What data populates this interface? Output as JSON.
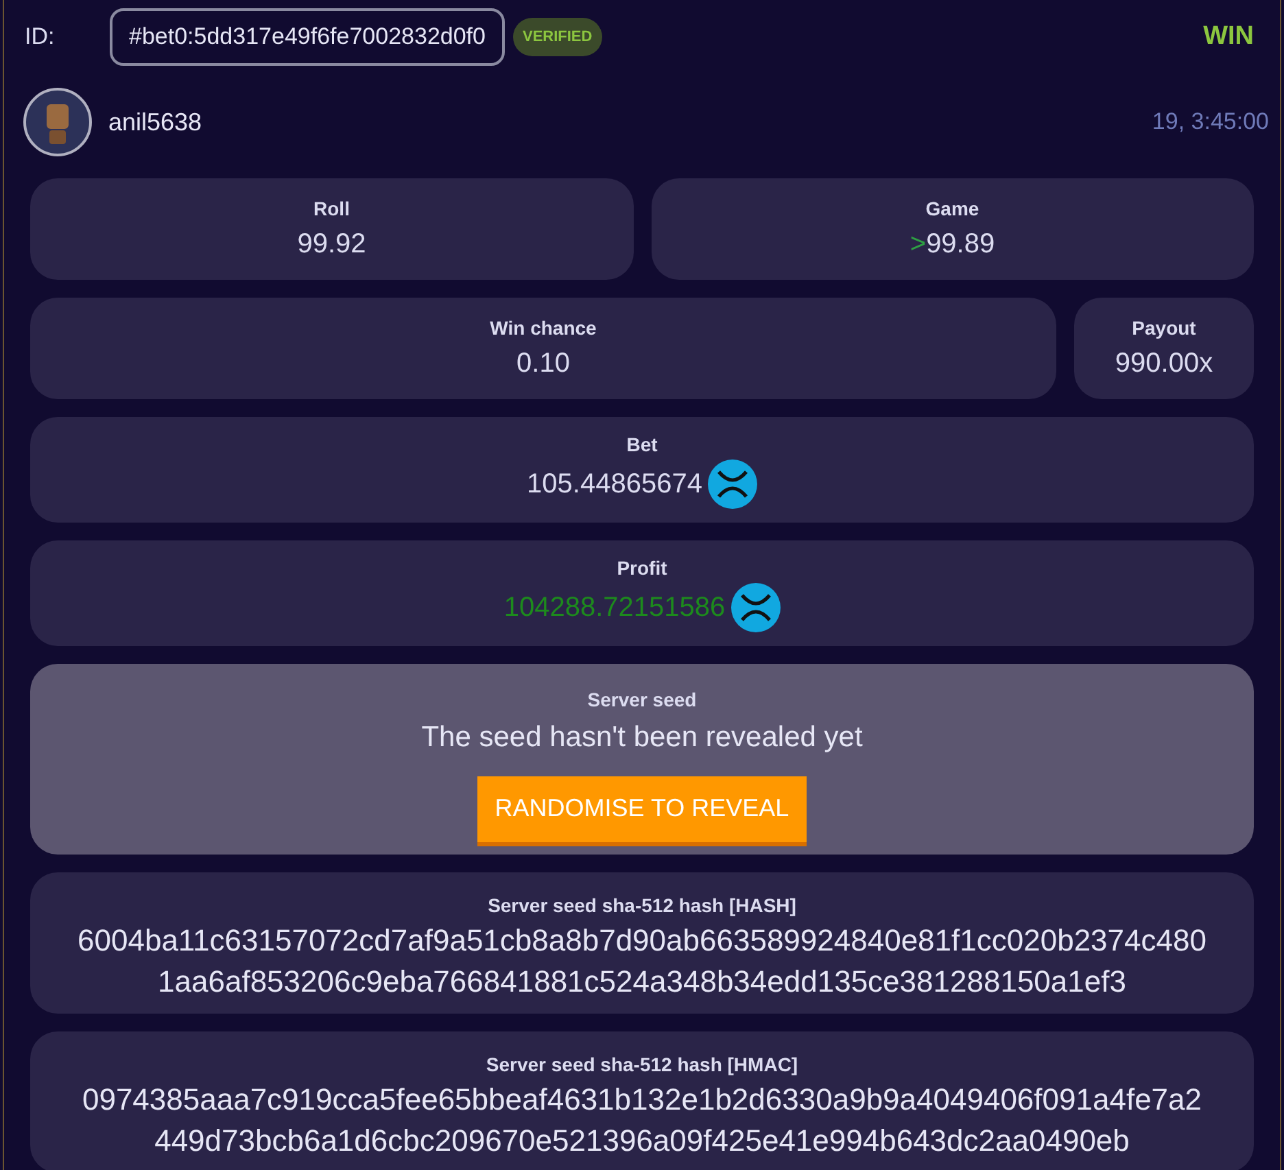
{
  "header": {
    "id_label": "ID:",
    "id_value": "#bet0:5dd317e49f6fe7002832d0f0",
    "badge": "VERIFIED",
    "result": "WIN",
    "win": true
  },
  "user": {
    "name": "anil5638",
    "time": "19, 3:45:00"
  },
  "rows": [
    {
      "cards": [
        {
          "label": "Roll",
          "value": "99.92"
        },
        {
          "label": "Game",
          "comparator": ">",
          "value": "99.89"
        }
      ]
    },
    {
      "cards": [
        {
          "label": "Win chance",
          "value": "0.10",
          "wide": true
        },
        {
          "label": "Payout",
          "value": "990.00x"
        }
      ]
    },
    {
      "cards": [
        {
          "label": "Bet",
          "value": "105.44865674",
          "coin": true
        }
      ]
    },
    {
      "cards": [
        {
          "label": "Profit",
          "value": "104288.72151586",
          "coin": true,
          "positive": true
        }
      ]
    }
  ],
  "server_seed": {
    "label": "Server seed",
    "message": "The seed hasn't been revealed yet",
    "button": "RANDOMISE TO REVEAL"
  },
  "hashes": [
    {
      "label": "Server seed sha-512 hash [HASH]",
      "lines": [
        "6004ba11c63157072cd7af9a51cb8a8b7d90ab663589924840e81f1cc020b2374c480",
        "1aa6af853206c9eba766841881c524a348b34edd135ce381288150a1ef3"
      ]
    },
    {
      "label": "Server seed sha-512 hash [HMAC]",
      "lines": [
        "0974385aaa7c919cca5fee65bbeaf4631b132e1b2d6330a9b9a4049406f091a4fe7a2",
        "449d73bcb6a1d6cbc209670e521396a09f425e41e994b643dc2aa0490eb"
      ]
    }
  ]
}
